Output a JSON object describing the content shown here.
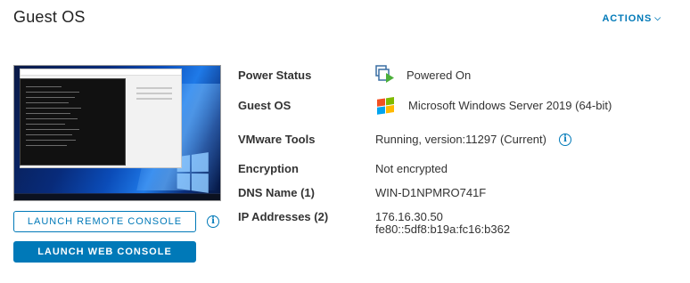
{
  "header": {
    "title": "Guest OS",
    "actions_label": "ACTIONS",
    "actions_icon": "chevron-down-icon"
  },
  "console": {
    "launch_remote_label": "LAUNCH REMOTE CONSOLE",
    "launch_web_label": "LAUNCH WEB CONSOLE"
  },
  "properties": {
    "power_status": {
      "label": "Power Status",
      "value": "Powered On",
      "icon": "powered-on-vm-icon"
    },
    "guest_os": {
      "label": "Guest OS",
      "value": "Microsoft Windows Server 2019 (64-bit)",
      "icon": "windows-logo-icon"
    },
    "vmware_tools": {
      "label": "VMware Tools",
      "value": "Running, version:11297 (Current)"
    },
    "encryption": {
      "label": "Encryption",
      "value": "Not encrypted"
    },
    "dns_name": {
      "label": "DNS Name (1)",
      "value": "WIN-D1NPMRO741F"
    },
    "ip_addresses": {
      "label": "IP Addresses (2)",
      "values": [
        "176.16.30.50",
        "fe80::5df8:b19a:fc16:b362"
      ]
    }
  },
  "colors": {
    "accent": "#0079b8",
    "power_on_green": "#4caf3a"
  }
}
